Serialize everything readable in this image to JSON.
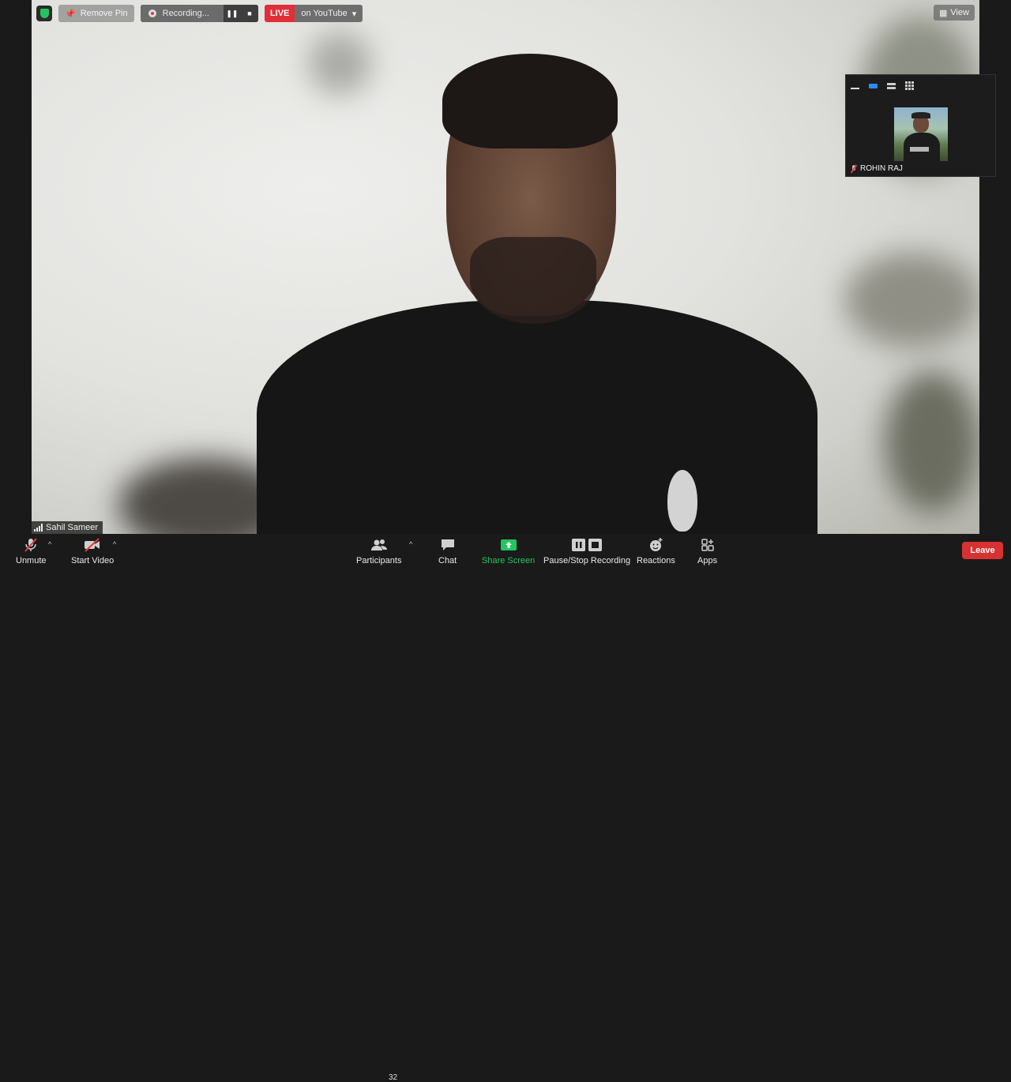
{
  "top_bar": {
    "remove_pin": "Remove Pin",
    "recording": "Recording...",
    "live": "LIVE",
    "live_destination": "on YouTube",
    "view": "View"
  },
  "thumbnail": {
    "participant_name": "ROHIN RAJ"
  },
  "main_video": {
    "speaker_name": "Sahil Sameer"
  },
  "toolbar": {
    "unmute": "Unmute",
    "start_video": "Start Video",
    "participants": "Participants",
    "participant_count": "32",
    "chat": "Chat",
    "share_screen": "Share Screen",
    "pause_stop_recording": "Pause/Stop Recording",
    "reactions": "Reactions",
    "apps": "Apps",
    "leave": "Leave"
  },
  "colors": {
    "live_red": "#e02f38",
    "share_green": "#23c55e",
    "leave_red": "#d63232",
    "accent_blue": "#2d8cff"
  }
}
